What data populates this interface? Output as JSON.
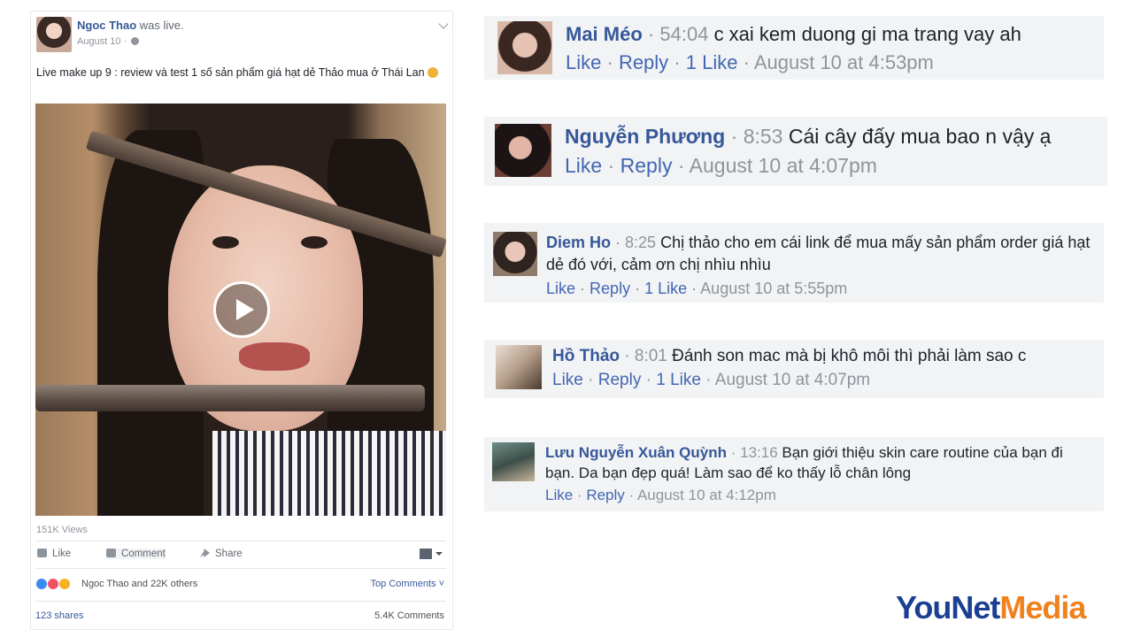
{
  "post": {
    "author": "Ngoc Thao",
    "action": "was live.",
    "time": "August 10 ·",
    "text": "Live make up 9 : review và test 1 số sản phẩm giá hạt dẻ Thảo mua ở Thái Lan",
    "views": "151K Views",
    "actions": {
      "like": "Like",
      "comment": "Comment",
      "share": "Share"
    },
    "reactions_text": "Ngoc Thao and 22K others",
    "top_comments": "Top Comments ˅",
    "shares": "123 shares",
    "comments_count": "5.4K Comments"
  },
  "comments": [
    {
      "name": "Mai Méo",
      "time": "54:04",
      "text": "c xai kem duong gi ma trang vay ah",
      "like": "Like",
      "reply": "Reply",
      "likes": "1 Like",
      "date": "August 10 at 4:53pm"
    },
    {
      "name": "Nguyễn Phương",
      "time": "8:53",
      "text": "Cái cây đấy mua bao n vậy ạ",
      "like": "Like",
      "reply": "Reply",
      "date": "August 10 at 4:07pm"
    },
    {
      "name": "Diem Ho",
      "time": "8:25",
      "text": "Chị thảo cho em cái link để mua mấy sản phẩm order giá hạt",
      "text2": "dẻ đó với, cảm ơn chị nhìu nhìu",
      "like": "Like",
      "reply": "Reply",
      "likes": "1 Like",
      "date": "August 10 at 5:55pm"
    },
    {
      "name": "Hồ Thảo",
      "time": "8:01",
      "text": "Đánh son mac mà bị khô môi thì phải làm sao c",
      "like": "Like",
      "reply": "Reply",
      "likes": "1 Like",
      "date": "August 10 at 4:07pm"
    },
    {
      "name": "Lưu Nguyễn Xuân Quỳnh",
      "time": "13:16",
      "text": "Bạn giới thiệu skin care routine của bạn đi",
      "text2": "bạn. Da bạn đẹp quá! Làm sao để ko thấy lỗ chân lông",
      "like": "Like",
      "reply": "Reply",
      "date": "August 10 at 4:12pm"
    }
  ],
  "logo": {
    "part1": "YouNet",
    "part2": "Media"
  },
  "colors": {
    "link": "#365899",
    "brand_blue": "#1a3f93",
    "brand_orange": "#f0821e"
  }
}
